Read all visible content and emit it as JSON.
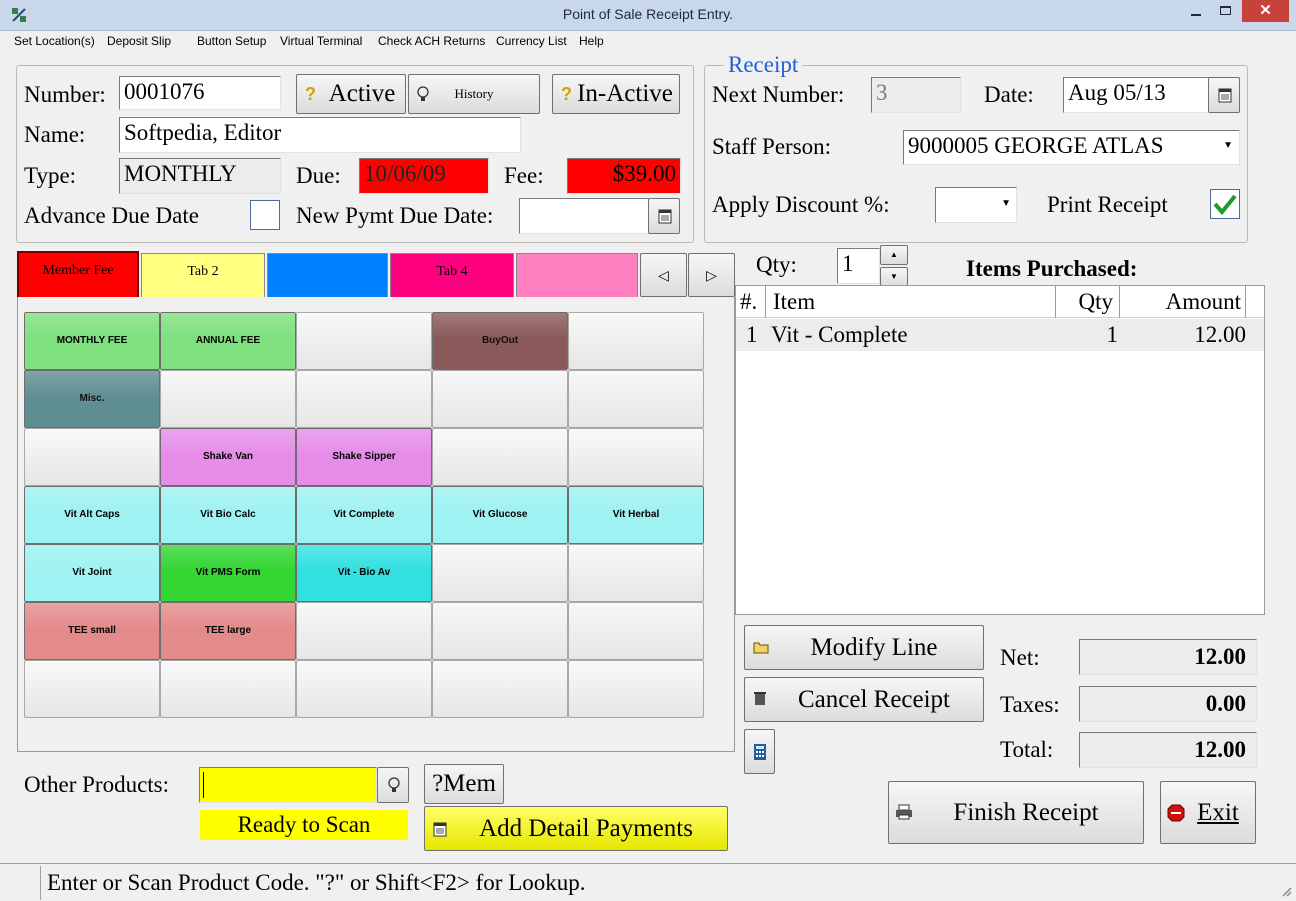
{
  "window": {
    "title": "Point of Sale Receipt Entry."
  },
  "menu": [
    "Set Location(s)",
    "Deposit Slip",
    "Button Setup",
    "Virtual Terminal",
    "Check ACH Returns",
    "Currency List",
    "Help"
  ],
  "member": {
    "number_label": "Number:",
    "number_value": "0001076",
    "active_label": "Active",
    "history_label": "History",
    "inactive_label": "In-Active",
    "name_label": "Name:",
    "name_value": "Softpedia, Editor",
    "type_label": "Type:",
    "type_value": "MONTHLY",
    "due_label": "Due:",
    "due_value": "10/06/09",
    "fee_label": "Fee:",
    "fee_value": "$39.00",
    "advance_label": "Advance Due Date",
    "newdue_label": "New Pymt Due Date:",
    "newdue_value": ""
  },
  "receipt": {
    "legend": "Receipt",
    "next_label": "Next Number:",
    "next_value": "3",
    "date_label": "Date:",
    "date_value": "Aug 05/13",
    "staff_label": "Staff Person:",
    "staff_value": "9000005 GEORGE ATLAS",
    "discount_label": "Apply Discount %:",
    "discount_value": "",
    "print_label": "Print Receipt",
    "print_checked": true
  },
  "tabs": [
    {
      "label": "Member Fee",
      "color": "#ff0000"
    },
    {
      "label": "Tab 2",
      "color": "#ffff80"
    },
    {
      "label": "",
      "color": "#0080ff"
    },
    {
      "label": "Tab 4",
      "color": "#ff0080"
    },
    {
      "label": "",
      "color": "#ff80c0"
    }
  ],
  "products": [
    {
      "label": "MONTHLY FEE",
      "color": "green"
    },
    {
      "label": "ANNUAL FEE",
      "color": "green"
    },
    {
      "label": "BuyOut",
      "color": "brown"
    },
    {
      "label": "Misc.",
      "color": "teal"
    },
    {
      "label": "Shake Van",
      "color": "pink"
    },
    {
      "label": "Shake Sipper",
      "color": "pink"
    },
    {
      "label": "Vit Alt Caps",
      "color": "cyan"
    },
    {
      "label": "Vit Bio Calc",
      "color": "cyan"
    },
    {
      "label": "Vit Complete",
      "color": "cyan"
    },
    {
      "label": "Vit Glucose",
      "color": "cyan"
    },
    {
      "label": "Vit Herbal",
      "color": "cyan"
    },
    {
      "label": "Vit Joint",
      "color": "cyan"
    },
    {
      "label": "Vit PMS Form",
      "color": "brightgreen"
    },
    {
      "label": "Vit - Bio Av",
      "color": "brightcyan"
    },
    {
      "label": "TEE small",
      "color": "rose"
    },
    {
      "label": "TEE large",
      "color": "rose"
    }
  ],
  "purchase": {
    "qty_label": "Qty:",
    "qty_value": "1",
    "title": "Items Purchased:",
    "columns": [
      "#.",
      "Item",
      "Qty",
      "Amount"
    ],
    "rows": [
      {
        "num": "1",
        "item": "Vit - Complete",
        "qty": "1",
        "amount": "12.00"
      }
    ]
  },
  "actions": {
    "modify_label": "Modify Line",
    "cancel_label": "Cancel Receipt",
    "finish_label": "Finish Receipt",
    "exit_label": "Exit"
  },
  "totals": {
    "net_label": "Net:",
    "net_value": "12.00",
    "taxes_label": "Taxes:",
    "taxes_value": "0.00",
    "total_label": "Total:",
    "total_value": "12.00"
  },
  "other": {
    "label": "Other Products:",
    "value": "",
    "mem_label": "?Mem",
    "ready_label": "Ready to Scan",
    "add_detail_label": "Add Detail Payments"
  },
  "status": {
    "text": "Enter or Scan Product Code. \"?\" or Shift<F2> for Lookup."
  },
  "colors": {
    "green": "#7ee07e",
    "brown": "#8a5a5a",
    "teal": "#5f8f93",
    "pink": "#e58de8",
    "cyan": "#9ff2f2",
    "brightgreen": "#33d633",
    "brightcyan": "#33e0e0",
    "rose": "#e38b8b"
  }
}
